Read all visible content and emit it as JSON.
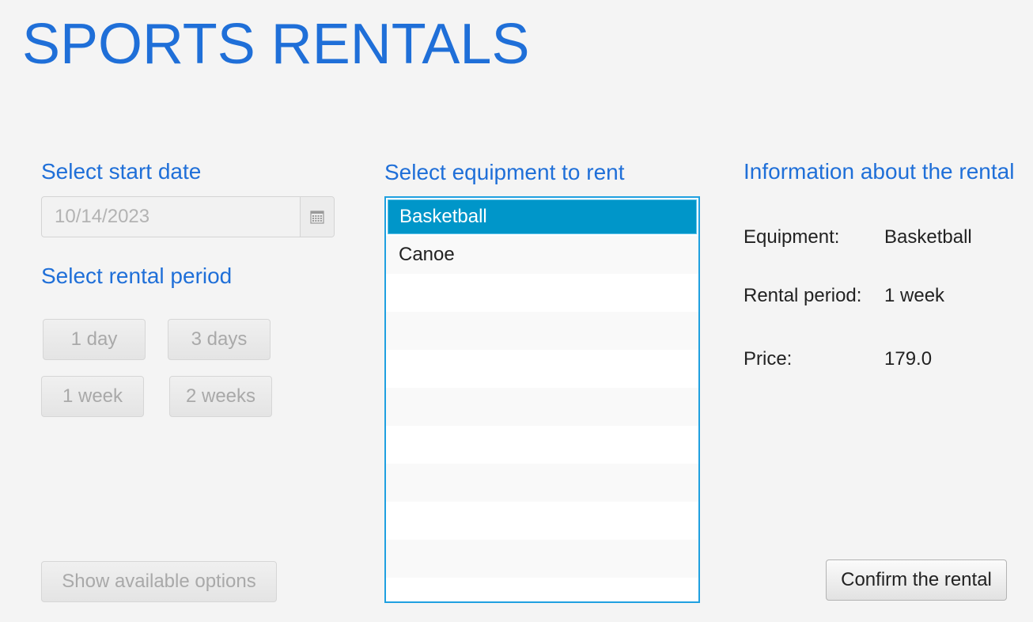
{
  "app": {
    "title": "SPORTS RENTALS"
  },
  "start_date": {
    "label": "Select start date",
    "value": "10/14/2023"
  },
  "rental_period": {
    "label": "Select rental period",
    "buttons": [
      "1 day",
      "3 days",
      "1 week",
      "2 weeks"
    ]
  },
  "show_options": {
    "label": "Show available options"
  },
  "equipment": {
    "label": "Select equipment to rent",
    "items": [
      "Basketball",
      "Canoe"
    ],
    "selected": "Basketball"
  },
  "info": {
    "label": "Information about the rental",
    "equipment_key": "Equipment:",
    "equipment_value": "Basketball",
    "period_key": "Rental period:",
    "period_value": "1 week",
    "price_key": "Price:",
    "price_value": "179.0"
  },
  "confirm": {
    "label": "Confirm the rental"
  },
  "colors": {
    "accent": "#1f6fd8",
    "selection": "#0096c9",
    "list_border": "#1fa0e0",
    "background": "#f4f4f4"
  },
  "icons": {
    "calendar": "calendar-icon"
  }
}
